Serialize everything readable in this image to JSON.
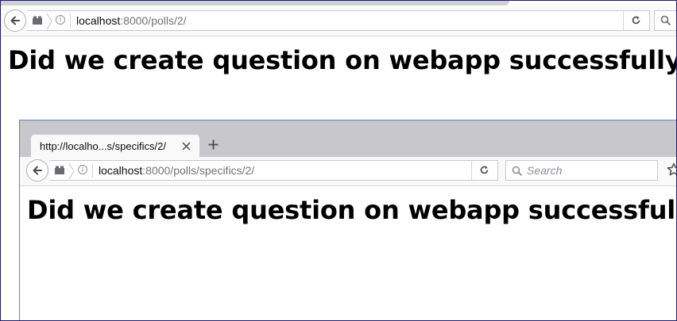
{
  "outer_browser": {
    "url_host": "localhost",
    "url_rest": ":8000/polls/2/",
    "heading": "Did we create question on webapp successfully?"
  },
  "inner_browser": {
    "tab_title": "http://localho...s/specifics/2/",
    "url_host": "localhost",
    "url_rest": ":8000/polls/specifics/2/",
    "search_placeholder": "Search",
    "heading": "Did we create question on webapp successfully?"
  },
  "icons": [
    "back-arrow-icon",
    "pages-icon",
    "chevron-right-icon",
    "info-icon",
    "reload-icon",
    "search-icon",
    "close-icon",
    "plus-icon",
    "star-icon"
  ],
  "colors": {
    "chrome_bg": "#f9f9fa",
    "tabstrip_bg": "#c8c8cc",
    "inner_border": "#6d79c0",
    "frame_border": "#1b1b6f"
  }
}
